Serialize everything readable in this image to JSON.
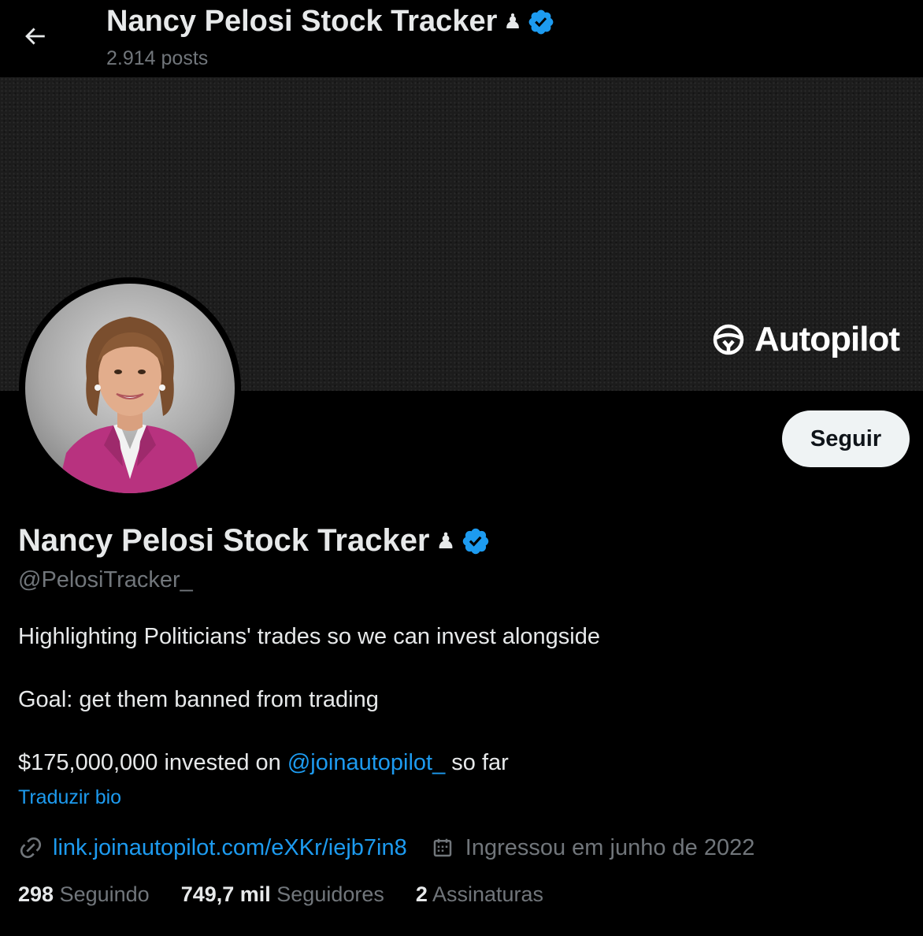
{
  "header": {
    "title": "Nancy Pelosi Stock Tracker",
    "title_emoji": "♟",
    "posts_count": "2.914 posts"
  },
  "banner": {
    "brand_name": "Autopilot"
  },
  "profile": {
    "name": "Nancy Pelosi Stock Tracker",
    "name_emoji": "♟",
    "handle": "@PelosiTracker_",
    "follow_label": "Seguir",
    "bio": {
      "line1": "Highlighting Politicians' trades so we can invest alongside",
      "line2": "Goal: get them banned from trading",
      "line3_prefix": "$175,000,000 invested on",
      "line3_mention": "@joinautopilot_",
      "line3_suffix": "so far"
    },
    "translate_label": "Traduzir bio",
    "link": "link.joinautopilot.com/eXKr/iejb7in8",
    "joined": "Ingressou em junho de 2022"
  },
  "stats": {
    "following_count": "298",
    "following_label": "Seguindo",
    "followers_count": "749,7 mil",
    "followers_label": "Seguidores",
    "subscriptions_count": "2",
    "subscriptions_label": "Assinaturas"
  },
  "colors": {
    "background": "#000000",
    "text": "#e7e9ea",
    "muted": "#71767b",
    "accent": "#1d9bf0",
    "button_bg": "#eff3f4"
  },
  "icons": {
    "back": "arrow-left-icon",
    "verified": "verified-badge-icon",
    "link": "link-icon",
    "calendar": "calendar-icon",
    "brand": "steering-wheel-icon"
  }
}
